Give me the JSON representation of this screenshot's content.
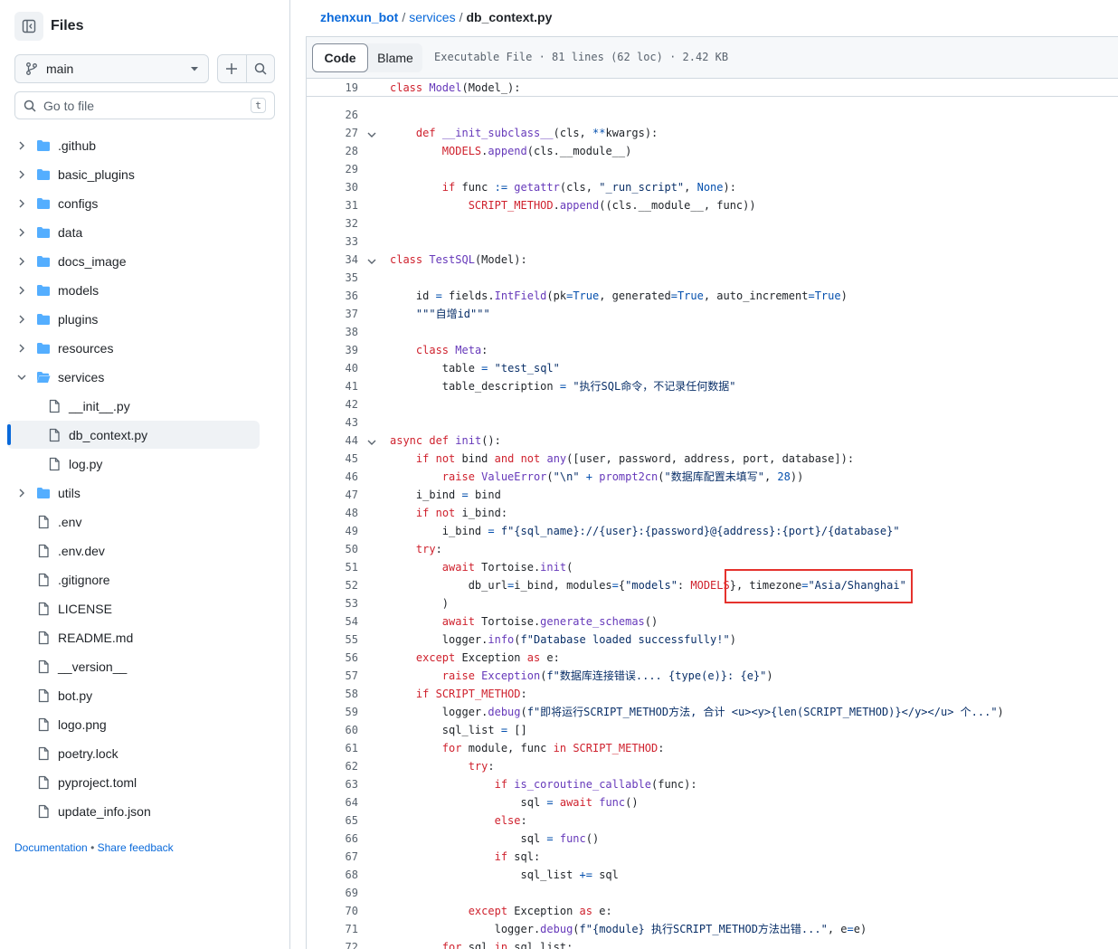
{
  "sidebar": {
    "title": "Files",
    "branch": "main",
    "search_placeholder": "Go to file",
    "search_shortcut": "t",
    "tree": [
      {
        "name": ".github",
        "type": "dir",
        "depth": 0,
        "open": false
      },
      {
        "name": "basic_plugins",
        "type": "dir",
        "depth": 0,
        "open": false
      },
      {
        "name": "configs",
        "type": "dir",
        "depth": 0,
        "open": false
      },
      {
        "name": "data",
        "type": "dir",
        "depth": 0,
        "open": false
      },
      {
        "name": "docs_image",
        "type": "dir",
        "depth": 0,
        "open": false
      },
      {
        "name": "models",
        "type": "dir",
        "depth": 0,
        "open": false
      },
      {
        "name": "plugins",
        "type": "dir",
        "depth": 0,
        "open": false
      },
      {
        "name": "resources",
        "type": "dir",
        "depth": 0,
        "open": false
      },
      {
        "name": "services",
        "type": "dir",
        "depth": 0,
        "open": true
      },
      {
        "name": "__init__.py",
        "type": "file",
        "depth": 1
      },
      {
        "name": "db_context.py",
        "type": "file",
        "depth": 1,
        "selected": true
      },
      {
        "name": "log.py",
        "type": "file",
        "depth": 1
      },
      {
        "name": "utils",
        "type": "dir",
        "depth": 0,
        "open": false
      },
      {
        "name": ".env",
        "type": "file",
        "depth": 0
      },
      {
        "name": ".env.dev",
        "type": "file",
        "depth": 0
      },
      {
        "name": ".gitignore",
        "type": "file",
        "depth": 0
      },
      {
        "name": "LICENSE",
        "type": "file",
        "depth": 0
      },
      {
        "name": "README.md",
        "type": "file",
        "depth": 0
      },
      {
        "name": "__version__",
        "type": "file",
        "depth": 0
      },
      {
        "name": "bot.py",
        "type": "file",
        "depth": 0
      },
      {
        "name": "logo.png",
        "type": "file",
        "depth": 0
      },
      {
        "name": "poetry.lock",
        "type": "file",
        "depth": 0
      },
      {
        "name": "pyproject.toml",
        "type": "file",
        "depth": 0
      },
      {
        "name": "update_info.json",
        "type": "file",
        "depth": 0
      }
    ],
    "footer_docs": "Documentation",
    "footer_sep": "•",
    "footer_feedback": "Share feedback"
  },
  "breadcrumb": {
    "repo": "zhenxun_bot",
    "sep": "/",
    "folder": "services",
    "file": "db_context.py"
  },
  "file_bar": {
    "code_tab": "Code",
    "blame_tab": "Blame",
    "info": "Executable File · 81 lines (62 loc) · 2.42 KB"
  },
  "colors": {
    "accent": "#0969da",
    "highlight_box": "#e5322d",
    "keyword": "#cf222e",
    "function": "#6639ba",
    "constant": "#0550ae",
    "string": "#0a3069"
  },
  "sticky_line": {
    "num": "19",
    "code": "class Model(Model_):"
  },
  "code_lines": [
    {
      "num": "26",
      "code": "",
      "fold": false
    },
    {
      "num": "27",
      "code": "    def __init_subclass__(cls, **kwargs):",
      "fold": true
    },
    {
      "num": "28",
      "code": "        MODELS.append(cls.__module__)",
      "fold": false
    },
    {
      "num": "29",
      "code": "",
      "fold": false
    },
    {
      "num": "30",
      "code": "        if func := getattr(cls, \"_run_script\", None):",
      "fold": false
    },
    {
      "num": "31",
      "code": "            SCRIPT_METHOD.append((cls.__module__, func))",
      "fold": false
    },
    {
      "num": "32",
      "code": "",
      "fold": false
    },
    {
      "num": "33",
      "code": "",
      "fold": false
    },
    {
      "num": "34",
      "code": "class TestSQL(Model):",
      "fold": true
    },
    {
      "num": "35",
      "code": "",
      "fold": false
    },
    {
      "num": "36",
      "code": "    id = fields.IntField(pk=True, generated=True, auto_increment=True)",
      "fold": false
    },
    {
      "num": "37",
      "code": "    \"\"\"自增id\"\"\"",
      "fold": false
    },
    {
      "num": "38",
      "code": "",
      "fold": false
    },
    {
      "num": "39",
      "code": "    class Meta:",
      "fold": false
    },
    {
      "num": "40",
      "code": "        table = \"test_sql\"",
      "fold": false
    },
    {
      "num": "41",
      "code": "        table_description = \"执行SQL命令，不记录任何数据\"",
      "fold": false
    },
    {
      "num": "42",
      "code": "",
      "fold": false
    },
    {
      "num": "43",
      "code": "",
      "fold": false
    },
    {
      "num": "44",
      "code": "async def init():",
      "fold": true
    },
    {
      "num": "45",
      "code": "    if not bind and not any([user, password, address, port, database]):",
      "fold": false
    },
    {
      "num": "46",
      "code": "        raise ValueError(\"\\n\" + prompt2cn(\"数据库配置未填写\", 28))",
      "fold": false
    },
    {
      "num": "47",
      "code": "    i_bind = bind",
      "fold": false
    },
    {
      "num": "48",
      "code": "    if not i_bind:",
      "fold": false
    },
    {
      "num": "49",
      "code": "        i_bind = f\"{sql_name}://{user}:{password}@{address}:{port}/{database}\"",
      "fold": false
    },
    {
      "num": "50",
      "code": "    try:",
      "fold": false
    },
    {
      "num": "51",
      "code": "        await Tortoise.init(",
      "fold": false
    },
    {
      "num": "52",
      "code": "            db_url=i_bind, modules={\"models\": MODELS}, timezone=\"Asia/Shanghai\"",
      "fold": false
    },
    {
      "num": "53",
      "code": "        )",
      "fold": false
    },
    {
      "num": "54",
      "code": "        await Tortoise.generate_schemas()",
      "fold": false
    },
    {
      "num": "55",
      "code": "        logger.info(f\"Database loaded successfully!\")",
      "fold": false
    },
    {
      "num": "56",
      "code": "    except Exception as e:",
      "fold": false
    },
    {
      "num": "57",
      "code": "        raise Exception(f\"数据库连接错误.... {type(e)}: {e}\")",
      "fold": false
    },
    {
      "num": "58",
      "code": "    if SCRIPT_METHOD:",
      "fold": false
    },
    {
      "num": "59",
      "code": "        logger.debug(f\"即将运行SCRIPT_METHOD方法, 合计 <u><y>{len(SCRIPT_METHOD)}</y></u> 个...\")",
      "fold": false
    },
    {
      "num": "60",
      "code": "        sql_list = []",
      "fold": false
    },
    {
      "num": "61",
      "code": "        for module, func in SCRIPT_METHOD:",
      "fold": false
    },
    {
      "num": "62",
      "code": "            try:",
      "fold": false
    },
    {
      "num": "63",
      "code": "                if is_coroutine_callable(func):",
      "fold": false
    },
    {
      "num": "64",
      "code": "                    sql = await func()",
      "fold": false
    },
    {
      "num": "65",
      "code": "                else:",
      "fold": false
    },
    {
      "num": "66",
      "code": "                    sql = func()",
      "fold": false
    },
    {
      "num": "67",
      "code": "                if sql:",
      "fold": false
    },
    {
      "num": "68",
      "code": "                    sql_list += sql",
      "fold": false
    },
    {
      "num": "69",
      "code": "",
      "fold": false
    },
    {
      "num": "70",
      "code": "            except Exception as e:",
      "fold": false
    },
    {
      "num": "71",
      "code": "                logger.debug(f\"{module} 执行SCRIPT_METHOD方法出错...\", e=e)",
      "fold": false
    },
    {
      "num": "72",
      "code": "        for sql in sql_list:",
      "fold": false
    }
  ]
}
